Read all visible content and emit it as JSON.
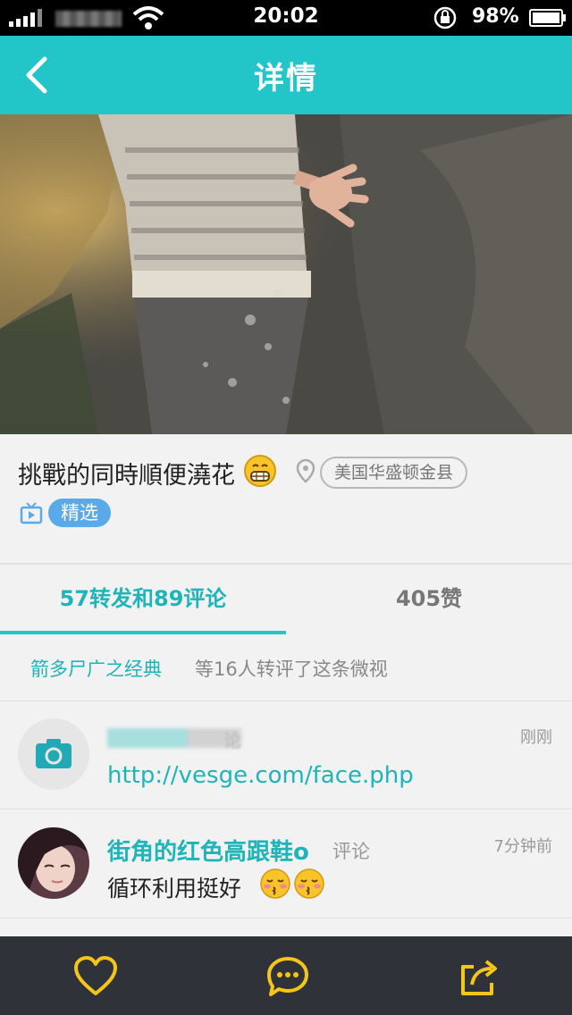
{
  "status_bar": {
    "time": "20:02",
    "battery": "98%",
    "icons": [
      "signal-icon",
      "wifi-icon",
      "rotation-lock-icon",
      "battery-icon"
    ]
  },
  "nav": {
    "title": "详情",
    "back_icon": "chevron-left-icon",
    "background": "#23c6c8"
  },
  "post": {
    "title": "挑戰的同時順便澆花",
    "emoji": "grinning-face-icon",
    "location": "美国华盛顿金县",
    "badge": "精选"
  },
  "tabs": [
    {
      "label": "57转发和89评论",
      "active": true
    },
    {
      "label": "405赞",
      "active": false
    }
  ],
  "reposters": {
    "names": "箭多尸广之经典",
    "text": "等16人转评了这条微视"
  },
  "comments": [
    {
      "user": "",
      "action": "论",
      "time": "刚刚",
      "text": "http://vesge.com/face.php",
      "avatar_icon": "camera-icon"
    },
    {
      "user": "街角的红色高跟鞋o",
      "action": "评论",
      "time": "7分钟前",
      "text": "循环利用挺好",
      "emojis": [
        "kiss-face-icon",
        "kiss-face-icon"
      ]
    }
  ],
  "bottom_bar": {
    "icons": [
      "heart-icon",
      "comment-icon",
      "share-icon"
    ],
    "accent": "#f5c518"
  },
  "colors": {
    "teal": "#23c6c8",
    "link": "#1fb5b8",
    "badge": "#5aa9e8",
    "dark_bar": "#2f3238"
  }
}
